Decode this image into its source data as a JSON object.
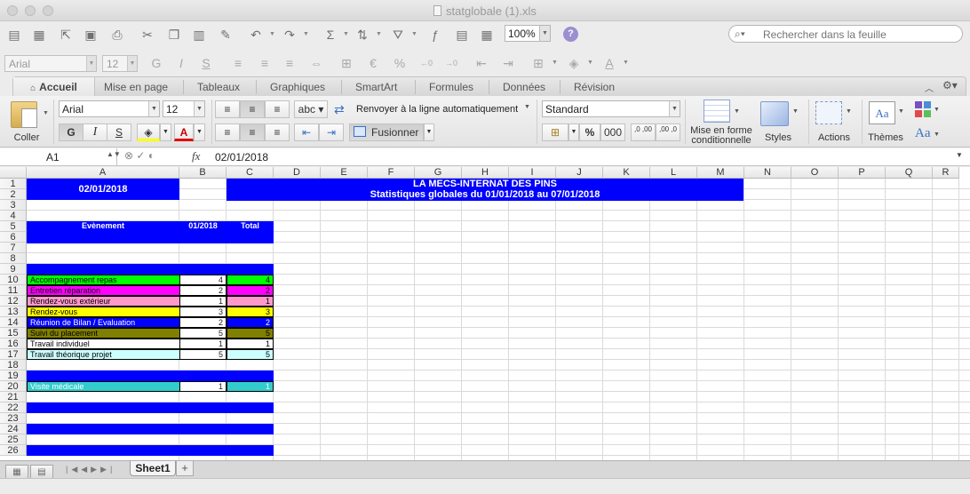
{
  "window": {
    "title": "statglobale (1).xls"
  },
  "toolbar": {
    "zoom": "100%",
    "search_placeholder": "Rechercher dans la feuille",
    "font_name": "Arial",
    "font_size": "12"
  },
  "ribbon": {
    "tabs": [
      "Accueil",
      "Mise en page",
      "Tableaux",
      "Graphiques",
      "SmartArt",
      "Formules",
      "Données",
      "Révision"
    ],
    "coller": "Coller",
    "font_name": "Arial",
    "font_size": "12",
    "bold": "G",
    "italic": "I",
    "underline": "S",
    "abc": "abc",
    "wrap_text": "Renvoyer à la ligne automatiquement",
    "merge": "Fusionner",
    "number_format": "Standard",
    "percent": "%",
    "thousands": "000",
    "dec_inc": ",0 ,00",
    "dec_dec": ",00 ,0",
    "cond_format_line1": "Mise en forme",
    "cond_format_line2": "conditionnelle",
    "styles": "Styles",
    "actions": "Actions",
    "themes": "Thèmes",
    "font_theme": "Aa"
  },
  "formula_bar": {
    "cell_ref": "A1",
    "fx": "fx",
    "value": "02/01/2018"
  },
  "grid": {
    "columns": [
      "A",
      "B",
      "C",
      "D",
      "E",
      "F",
      "G",
      "H",
      "I",
      "J",
      "K",
      "L",
      "M",
      "N",
      "O",
      "P",
      "Q",
      "R"
    ],
    "rows": [
      "1",
      "2",
      "3",
      "4",
      "5",
      "6",
      "7",
      "8",
      "9",
      "10",
      "11",
      "12",
      "13",
      "14",
      "15",
      "16",
      "17",
      "18",
      "19",
      "20",
      "21",
      "22",
      "23",
      "24",
      "25",
      "26"
    ],
    "date_cell": "02/01/2018",
    "title1": "LA MECS-INTERNAT DES PINS",
    "title2": "Statistiques globales du 01/01/2018 au 07/01/2018",
    "header": {
      "event": "Evènement",
      "date": "01/2018",
      "total": "Total"
    },
    "events": [
      {
        "name": "Accompagnement repas",
        "value": "4",
        "total": "4",
        "bg": "#00ff00",
        "fg": "#000000",
        "total_bg": "#00ff00",
        "total_fg": "#000000"
      },
      {
        "name": "Entretien réparation",
        "value": "2",
        "total": "2",
        "bg": "#ff00ff",
        "fg": "#000000",
        "total_bg": "#ff00ff",
        "total_fg": "#000000"
      },
      {
        "name": "Rendez-vous extérieur",
        "value": "1",
        "total": "1",
        "bg": "#ff99cc",
        "fg": "#000000",
        "total_bg": "#ff99cc",
        "total_fg": "#000000"
      },
      {
        "name": "Rendez-vous",
        "value": "3",
        "total": "3",
        "bg": "#ffff00",
        "fg": "#000000",
        "total_bg": "#ffff00",
        "total_fg": "#000000"
      },
      {
        "name": "Réunion de Bilan / Evaluation",
        "value": "2",
        "total": "2",
        "bg": "#0000ff",
        "fg": "#ffffff",
        "total_bg": "#0000ff",
        "total_fg": "#ffffff"
      },
      {
        "name": "Suivi du placement",
        "value": "5",
        "total": "5",
        "bg": "#808000",
        "fg": "#000000",
        "total_bg": "#808000",
        "total_fg": "#000000"
      },
      {
        "name": "Travail individuel",
        "value": "1",
        "total": "1",
        "bg": "#ffffff",
        "fg": "#000000",
        "total_bg": "#ffffff",
        "total_fg": "#000000"
      },
      {
        "name": "Travail théorique projet",
        "value": "5",
        "total": "5",
        "bg": "#ccffff",
        "fg": "#000000",
        "total_bg": "#ccffff",
        "total_fg": "#000000"
      }
    ],
    "visite": {
      "name": "Visite médicale",
      "value": "1",
      "total": "1",
      "bg": "#33cccc",
      "fg": "#ffffff"
    }
  },
  "sheets": {
    "active": "Sheet1",
    "add": "+"
  }
}
